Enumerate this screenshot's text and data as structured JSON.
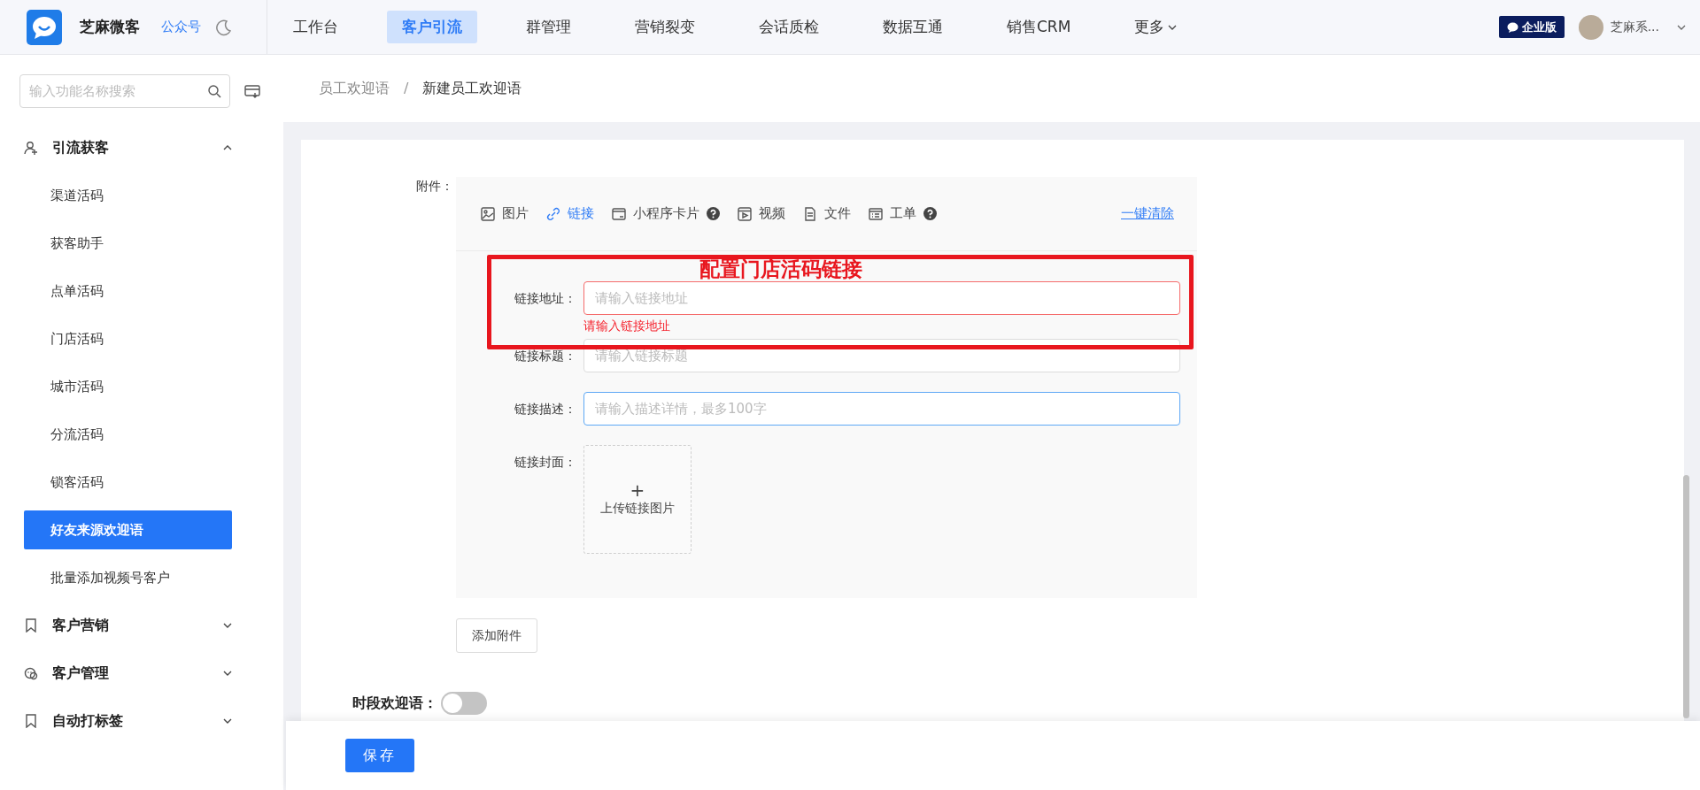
{
  "header": {
    "brand": "芝麻微客",
    "account_link": "公众号",
    "nav": [
      {
        "label": "工作台",
        "selected": false
      },
      {
        "label": "客户引流",
        "selected": true
      },
      {
        "label": "群管理",
        "selected": false
      },
      {
        "label": "营销裂变",
        "selected": false
      },
      {
        "label": "会话质检",
        "selected": false
      },
      {
        "label": "数据互通",
        "selected": false
      },
      {
        "label": "销售CRM",
        "selected": false
      }
    ],
    "more": "更多",
    "edition_badge": "企业版",
    "user_name": "芝麻系..."
  },
  "sidebar": {
    "search_placeholder": "输入功能名称搜索",
    "groups": [
      {
        "label": "引流获客",
        "kind": "person",
        "expanded": true,
        "children": [
          {
            "label": "渠道活码",
            "selected": false
          },
          {
            "label": "获客助手",
            "selected": false
          },
          {
            "label": "点单活码",
            "selected": false
          },
          {
            "label": "门店活码",
            "selected": false
          },
          {
            "label": "城市活码",
            "selected": false
          },
          {
            "label": "分流活码",
            "selected": false
          },
          {
            "label": "锁客活码",
            "selected": false
          },
          {
            "label": "好友来源欢迎语",
            "selected": true
          },
          {
            "label": "批量添加视频号客户",
            "selected": false
          }
        ]
      },
      {
        "label": "客户营销",
        "kind": "bookmark",
        "expanded": false
      },
      {
        "label": "客户管理",
        "kind": "chat",
        "expanded": false
      },
      {
        "label": "自动打标签",
        "kind": "bookmark",
        "expanded": false
      }
    ]
  },
  "breadcrumb": {
    "items": [
      "员工欢迎语",
      "新建员工欢迎语"
    ],
    "separator": "/"
  },
  "form": {
    "attachment_label": "附件：",
    "attachment_types": [
      {
        "label": "图片",
        "kind": "image",
        "selected": false,
        "help": false
      },
      {
        "label": "链接",
        "kind": "link",
        "selected": true,
        "help": false
      },
      {
        "label": "小程序卡片",
        "kind": "card",
        "selected": false,
        "help": true
      },
      {
        "label": "视频",
        "kind": "video",
        "selected": false,
        "help": false
      },
      {
        "label": "文件",
        "kind": "file",
        "selected": false,
        "help": false
      },
      {
        "label": "工单",
        "kind": "list",
        "selected": false,
        "help": true
      }
    ],
    "clear_all": "一键清除",
    "fields": [
      {
        "label": "链接地址：",
        "placeholder": "请输入链接地址",
        "error": "请输入链接地址",
        "focused": false
      },
      {
        "label": "链接标题：",
        "placeholder": "请输入链接标题",
        "focused": false
      },
      {
        "label": "链接描述：",
        "placeholder": "请输入描述详情，最多100字",
        "focused": true
      }
    ],
    "cover": {
      "label": "链接封面：",
      "plus": "+",
      "upload_text": "上传链接图片"
    },
    "add_attachment": "添加附件",
    "time_greeting": {
      "label": "时段欢迎语：",
      "on": false
    }
  },
  "annotation": {
    "text": "配置门店活码链接"
  },
  "footer": {
    "save": "保存"
  }
}
